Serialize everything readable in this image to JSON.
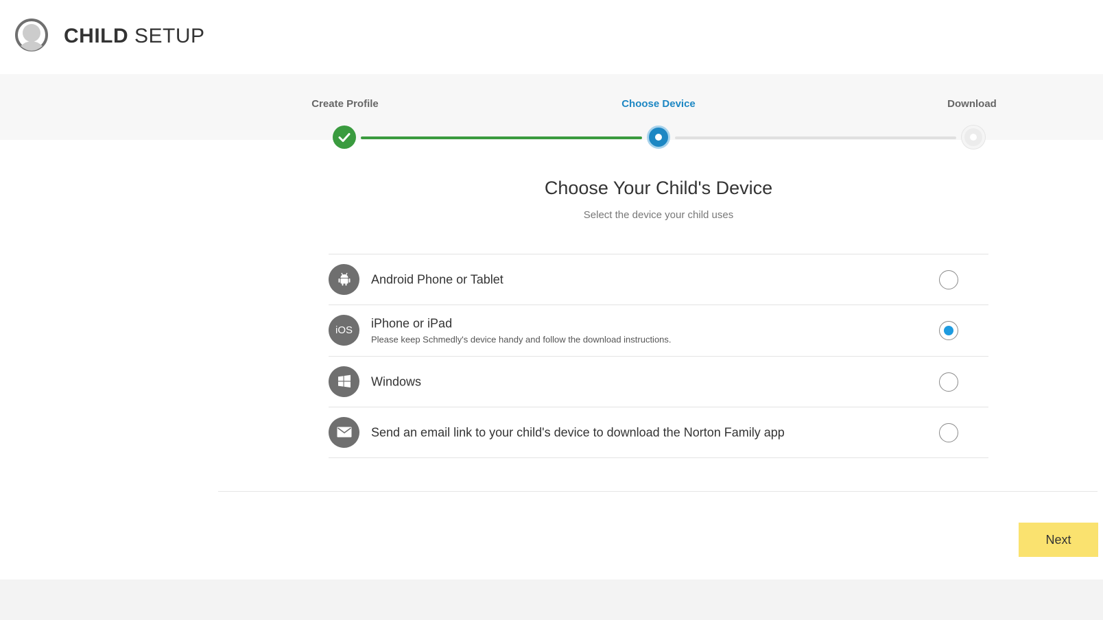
{
  "header": {
    "title_bold": "CHILD",
    "title_rest": "SETUP",
    "avatar_icon": "child-avatar-icon"
  },
  "stepper": {
    "steps": [
      {
        "label": "Create Profile",
        "state": "complete"
      },
      {
        "label": "Choose Device",
        "state": "active"
      },
      {
        "label": "Download",
        "state": "upcoming"
      }
    ],
    "colors": {
      "complete": "#3a9b3f",
      "active": "#1d87c3",
      "upcoming": "#e0e0e0"
    }
  },
  "main": {
    "heading": "Choose Your Child's Device",
    "subheading": "Select the device your child uses"
  },
  "devices": [
    {
      "label": "Android Phone or Tablet",
      "icon": "android-icon",
      "selected": false
    },
    {
      "label": "iPhone or iPad",
      "icon": "ios-icon",
      "icon_text": "iOS",
      "note": "Please keep Schmedly's device handy and follow the download instructions.",
      "selected": true
    },
    {
      "label": "Windows",
      "icon": "windows-icon",
      "selected": false
    },
    {
      "label": "Send an email link to your child's device to download the Norton Family app",
      "icon": "email-icon",
      "selected": false
    }
  ],
  "footer": {
    "next_label": "Next",
    "next_color": "#fae26f"
  }
}
